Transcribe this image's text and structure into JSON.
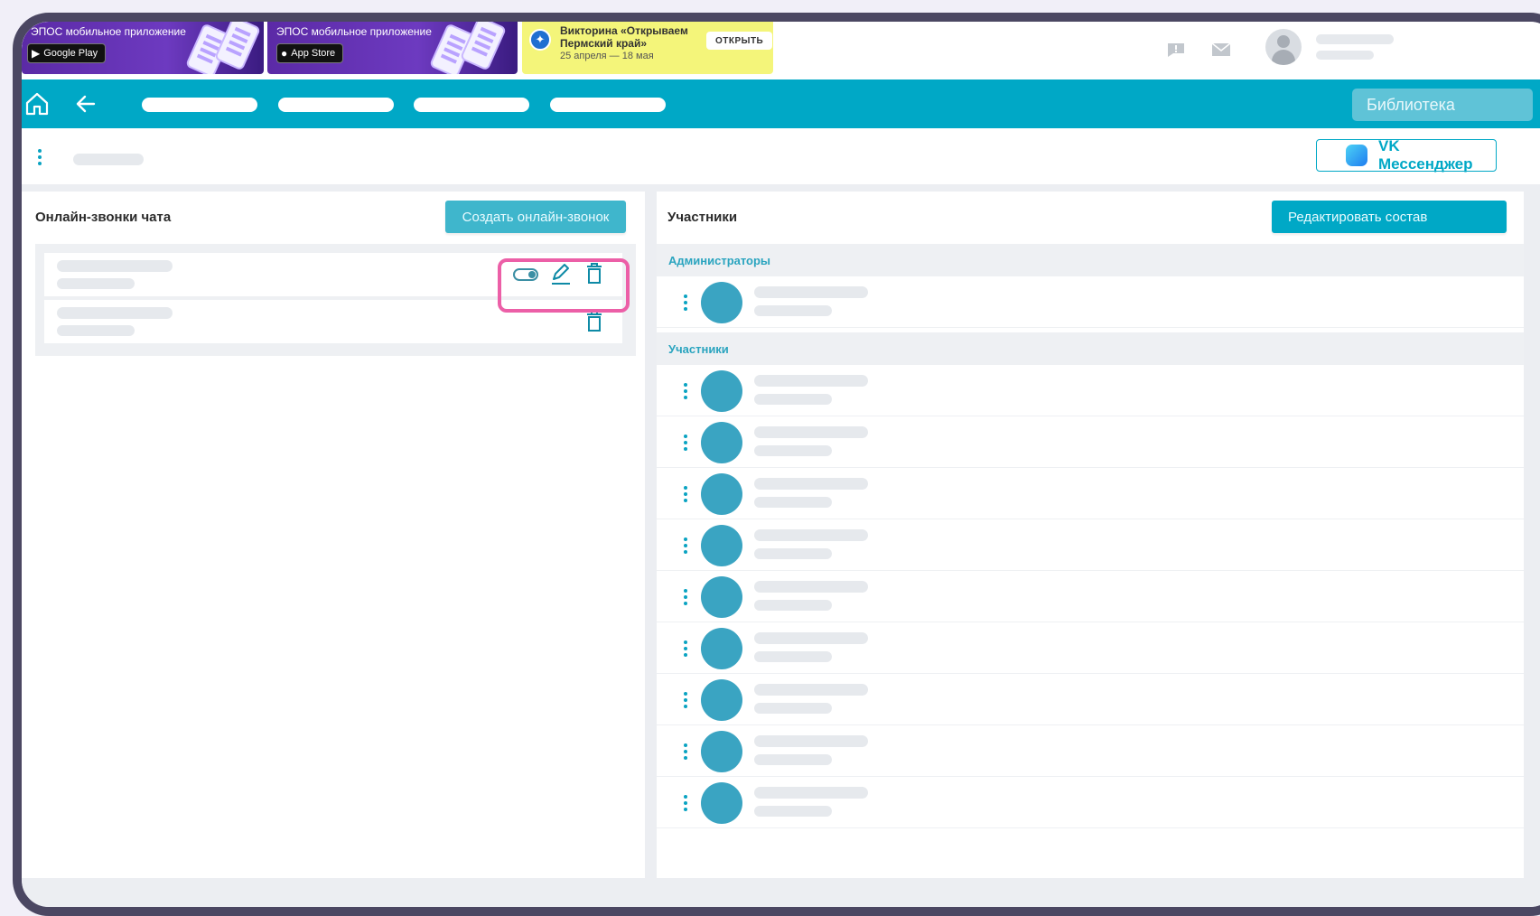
{
  "banner": {
    "promo_google": {
      "text": "ЭПОС мобильное приложение",
      "store": "Google Play"
    },
    "promo_apple": {
      "text": "ЭПОС мобильное приложение",
      "store": "App Store"
    },
    "quiz": {
      "title": "Викторина «Открываем Пермский край»",
      "dates": "25 апреля — 18 мая",
      "open_label": "ОТКРЫТЬ"
    }
  },
  "nav": {
    "library_label": "Библиотека"
  },
  "subbar": {
    "vk_label": "VK Мессенджер"
  },
  "calls": {
    "title": "Онлайн-звонки чата",
    "create_label": "Создать онлайн-звонок"
  },
  "participants": {
    "title": "Участники",
    "edit_label": "Редактировать состав",
    "admins_header": "Администраторы",
    "members_header": "Участники",
    "admins_count": 1,
    "members_count": 9
  },
  "colors": {
    "accent": "#00a8c6",
    "highlight": "#ec5fa7",
    "avatar": "#3aa4c2"
  }
}
